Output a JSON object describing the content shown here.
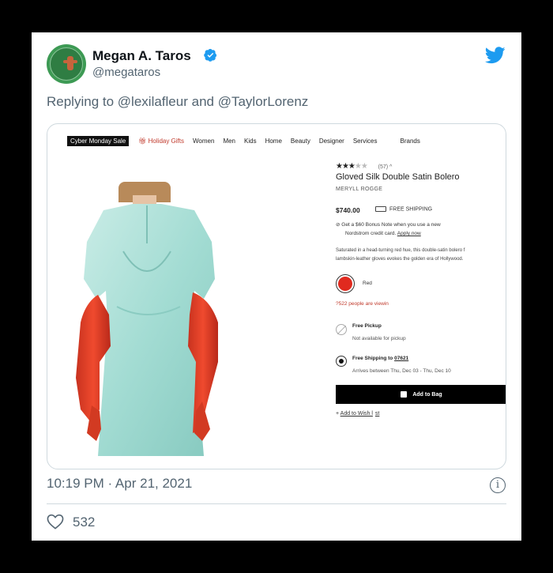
{
  "tweet": {
    "author_name": "Megan A. Taros",
    "handle": "@megataros",
    "replying_prefix": "Replying to",
    "mention_1": "@lexilafleur",
    "replying_and": "and",
    "mention_2": "@TaylorLorenz",
    "timestamp": "10:19 PM · Apr 21, 2021",
    "likes": "532",
    "info_glyph": "i",
    "icons": [
      "verified-badge-icon",
      "twitter-bird-icon",
      "info-icon",
      "heart-icon"
    ],
    "colors": {
      "text_secondary": "#536471",
      "twitter_blue": "#1d9bf0",
      "divider": "#cfd9de"
    }
  },
  "screenshot": {
    "nav": {
      "cyber": "Cyber Monday Sale",
      "items": [
        "Holiday Gifts",
        "Women",
        "Men",
        "Kids",
        "Home",
        "Beauty",
        "Designer",
        "Services"
      ],
      "brands": "Brands"
    },
    "product": {
      "stars": "★★★",
      "reviews": "(57) ^",
      "title": "Gloved Silk Double Satin Bolero",
      "brand": "MERYLL ROGGE",
      "price": "$740.00",
      "free_shipping": "FREE SHIPPING",
      "bonus_line1": "Get a $60 Bonus Note when you use a new",
      "bonus_line2": "Nordstrom credit card.",
      "apply_now": "Apply now",
      "desc_line1": "Saturated in a head-turning red hue, this double-satin bolero f",
      "desc_line2": "lambskin-leather gloves evokes the golden era of Hollywood.",
      "color_name": "Red",
      "viewing": "?522 people are viewin",
      "pickup_title": "Free Pickup",
      "pickup_sub": "Not available for pickup",
      "ship_title": "Free Shipping to",
      "ship_zip": "07621",
      "ship_sub": "Arrives between Thu, Dec 03 - Thu, Dec 10",
      "add_to_bag": "Add to Bag",
      "wish": "Add to Wish l",
      "wish_end": "st",
      "swatch_color": "#e02a1f"
    }
  }
}
